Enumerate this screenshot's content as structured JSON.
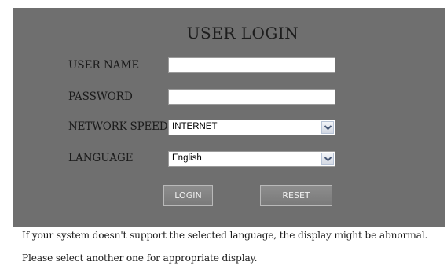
{
  "login": {
    "title": "USER LOGIN",
    "user_name_label": "USER NAME",
    "user_name_value": "",
    "password_label": "PASSWORD",
    "password_value": "",
    "network_speed_label": "NETWORK SPEED",
    "network_speed_value": "INTERNET",
    "language_label": "LANGUAGE",
    "language_value": "English",
    "login_button": "LOGIN",
    "reset_button": "RESET"
  },
  "notice": {
    "line1": "If your system doesn't support the selected language, the display might be abnormal.",
    "line2": "Please select another one for appropriate display."
  },
  "icons": {
    "dropdown": "chevron-down-icon"
  },
  "colors": {
    "panel": "#6f6f6f",
    "button": "#828282",
    "text": "#1a1a1a"
  }
}
